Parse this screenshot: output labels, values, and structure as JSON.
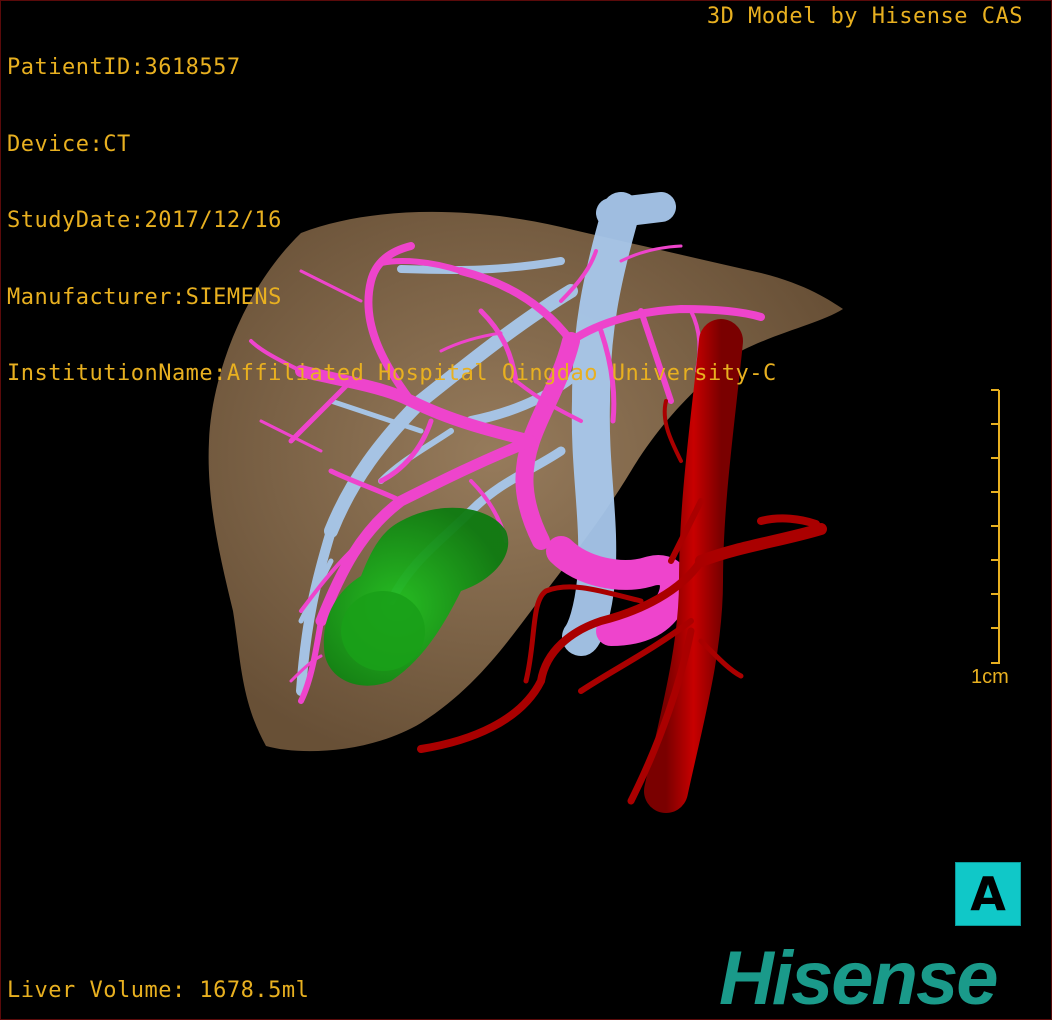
{
  "study_info": {
    "patient_id": "PatientID:3618557",
    "device": "Device:CT",
    "study_date": "StudyDate:2017/12/16",
    "manufacturer": "Manufacturer:SIEMENS",
    "institution": "InstitutionName:Affiliated Hospital Qingdao University-C"
  },
  "model_credit": "3D Model by Hisense CAS",
  "scale": {
    "label": "1cm",
    "ticks": 9
  },
  "orientation_label": "A",
  "liver_volume": "Liver Volume: 1678.5ml",
  "brand_logo": "Hisense",
  "colors": {
    "overlay_text": "#e8b020",
    "liver": "#b8946a",
    "portal_vein": "#ee44cc",
    "hepatic_vein": "#a8c8ec",
    "artery": "#aa0000",
    "lesion": "#18b020",
    "orientation_button": "#10c8c8",
    "logo": "#1a9a8a"
  }
}
